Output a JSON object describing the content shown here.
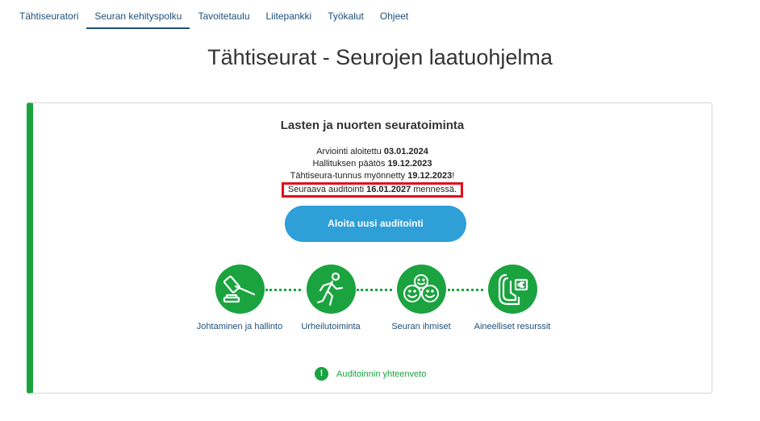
{
  "nav": {
    "items": [
      {
        "label": "Tähtiseuratori"
      },
      {
        "label": "Seuran kehityspolku"
      },
      {
        "label": "Tavoitetaulu"
      },
      {
        "label": "Liitepankki"
      },
      {
        "label": "Työkalut"
      },
      {
        "label": "Ohjeet"
      }
    ],
    "active": "Seuran kehityspolku"
  },
  "page_title": "Tähtiseurat - Seurojen laatuohjelma",
  "card": {
    "title": "Lasten ja nuorten seuratoiminta",
    "lines": [
      {
        "text": "Arviointi aloitettu ",
        "value": "03.01.2024",
        "suffix": ""
      },
      {
        "text": "Hallituksen päätös ",
        "value": "19.12.2023",
        "suffix": ""
      },
      {
        "text": "Tähtiseura-tunnus myönnetty ",
        "value": "19.12.2023",
        "suffix": "!"
      },
      {
        "text": "Seuraava auditointi ",
        "value": "16.01.2027",
        "suffix": " mennessä."
      }
    ],
    "start_button": "Aloita uusi auditointi",
    "steps": [
      {
        "label": "Johtaminen ja hallinto",
        "icon": "gavel-icon"
      },
      {
        "label": "Urheilutoiminta",
        "icon": "runner-icon"
      },
      {
        "label": "Seuran ihmiset",
        "icon": "smiley-faces-icon"
      },
      {
        "label": "Aineelliset resurssit",
        "icon": "euro-tag-icon"
      }
    ],
    "summary_icon": "!",
    "summary_label": "Auditoinnin yhteenveto"
  },
  "colors": {
    "green": "#1aa33f",
    "blue_button": "#2e9fd7",
    "nav_text": "#1f4f7a",
    "highlight": "#e0101a"
  }
}
